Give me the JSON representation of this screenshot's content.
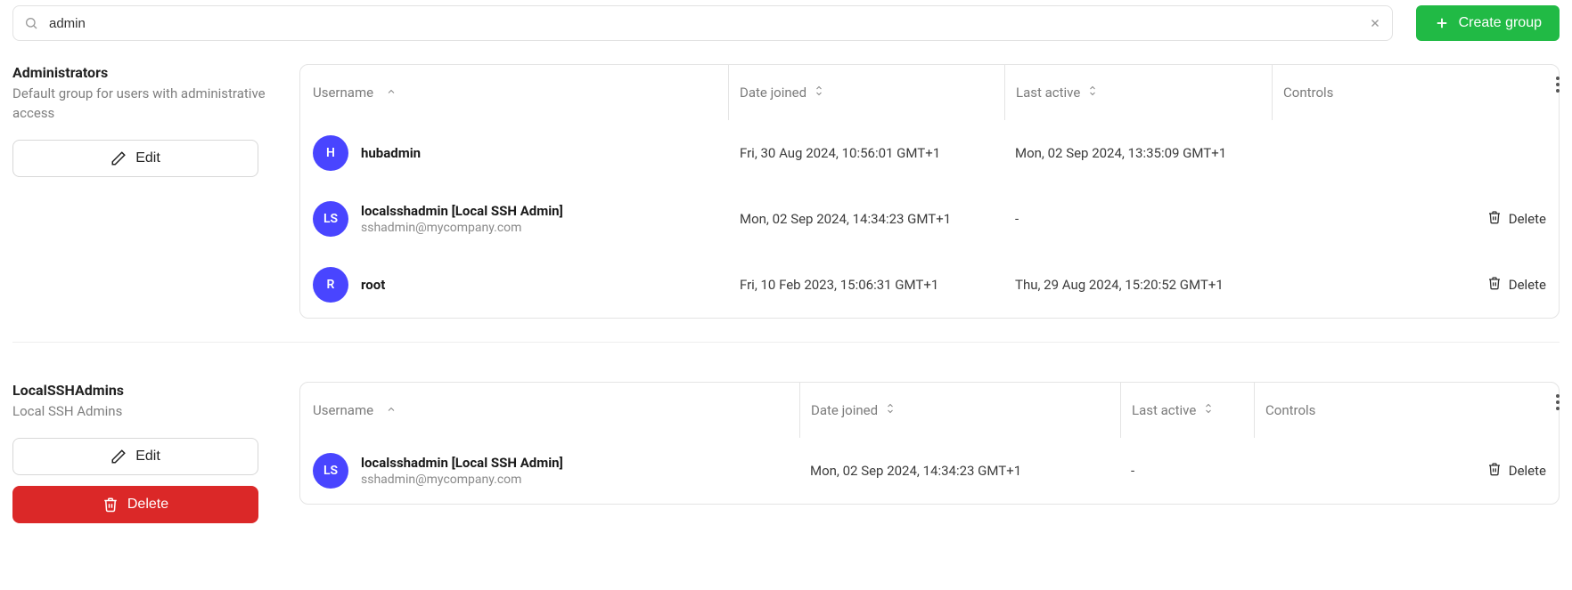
{
  "search": {
    "value": "admin",
    "placeholder": ""
  },
  "create_group_label": "Create group",
  "edit_label": "Edit",
  "delete_label": "Delete",
  "columns": {
    "username": "Username",
    "date_joined": "Date joined",
    "last_active": "Last active",
    "controls": "Controls"
  },
  "groups": [
    {
      "name": "Administrators",
      "description": "Default group for users with administrative access",
      "can_delete_group": false,
      "rows": [
        {
          "avatar": "H",
          "username": "hubadmin",
          "email": "",
          "date_joined": "Fri, 30 Aug 2024, 10:56:01 GMT+1",
          "last_active": "Mon, 02 Sep 2024, 13:35:09 GMT+1",
          "show_delete": false
        },
        {
          "avatar": "LS",
          "username": "localsshadmin [Local SSH Admin]",
          "email": "sshadmin@mycompany.com",
          "date_joined": "Mon, 02 Sep 2024, 14:34:23 GMT+1",
          "last_active": "-",
          "show_delete": true
        },
        {
          "avatar": "R",
          "username": "root",
          "email": "",
          "date_joined": "Fri, 10 Feb 2023, 15:06:31 GMT+1",
          "last_active": "Thu, 29 Aug 2024, 15:20:52 GMT+1",
          "show_delete": true
        }
      ]
    },
    {
      "name": "LocalSSHAdmins",
      "description": "Local SSH Admins",
      "can_delete_group": true,
      "rows": [
        {
          "avatar": "LS",
          "username": "localsshadmin [Local SSH Admin]",
          "email": "sshadmin@mycompany.com",
          "date_joined": "Mon, 02 Sep 2024, 14:34:23 GMT+1",
          "last_active": "-",
          "show_delete": true
        }
      ]
    }
  ]
}
